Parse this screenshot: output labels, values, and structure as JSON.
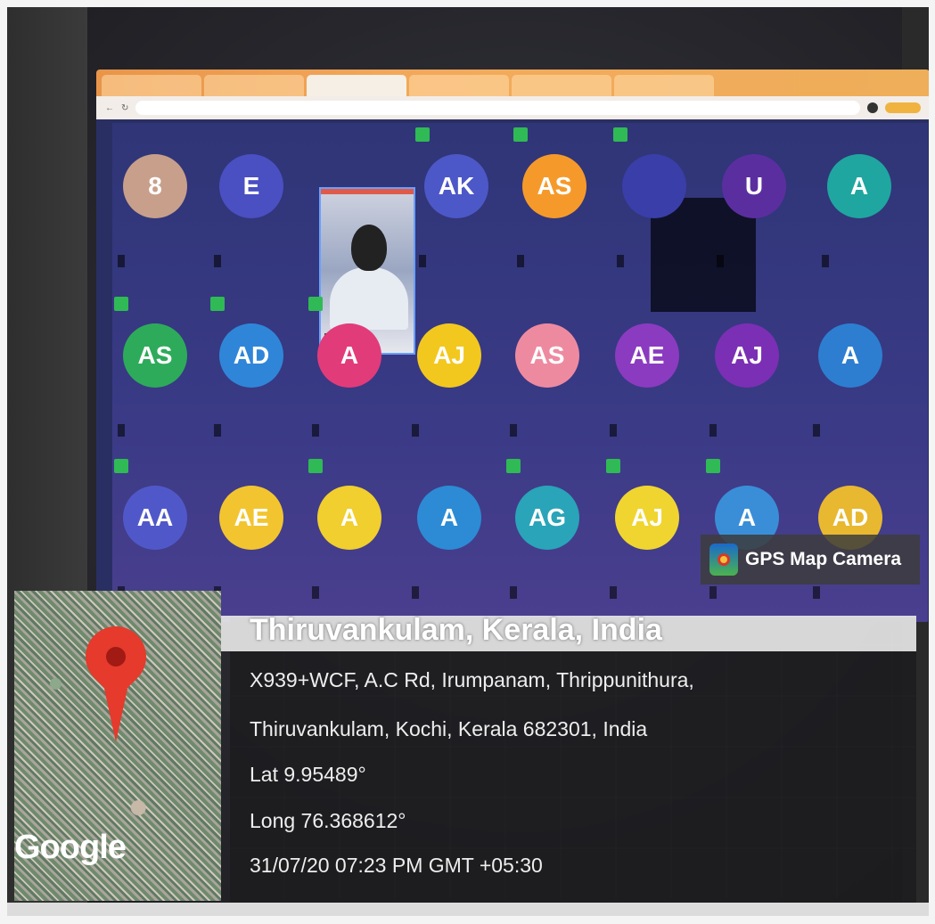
{
  "browser": {
    "tabs": [
      "",
      "",
      "",
      "",
      "",
      ""
    ],
    "url": ""
  },
  "meeting": {
    "tiles_row1": [
      {
        "initials": "8",
        "color": "#c89f8a",
        "name": ""
      },
      {
        "initials": "E",
        "color": "#4a4fc2",
        "name": ""
      },
      {
        "initials": "AK",
        "color": "#4c58c7",
        "name": ""
      },
      {
        "initials": "AS",
        "color": "#f59a2a",
        "name": ""
      },
      {
        "initials": "",
        "color": "#3a3ea8",
        "name": ""
      },
      {
        "initials": "U",
        "color": "#5b2ea0",
        "name": ""
      },
      {
        "initials": "A",
        "color": "#1fa6a0",
        "name": ""
      }
    ],
    "tiles_row2": [
      {
        "initials": "AS",
        "color": "#2dab5a",
        "name": ""
      },
      {
        "initials": "AD",
        "color": "#2f86d8",
        "name": ""
      },
      {
        "initials": "A",
        "color": "#e23b7a",
        "name": ""
      },
      {
        "initials": "AJ",
        "color": "#f2c81e",
        "name": ""
      },
      {
        "initials": "AS",
        "color": "#ee8aa0",
        "name": ""
      },
      {
        "initials": "AE",
        "color": "#8b3bc0",
        "name": ""
      },
      {
        "initials": "AJ",
        "color": "#7b2fb4",
        "name": ""
      },
      {
        "initials": "A",
        "color": "#2d7ed0",
        "name": ""
      }
    ],
    "tiles_row3": [
      {
        "initials": "AA",
        "color": "#5058c9",
        "name": ""
      },
      {
        "initials": "AE",
        "color": "#f2c530",
        "name": ""
      },
      {
        "initials": "A",
        "color": "#f0cf2e",
        "name": ""
      },
      {
        "initials": "A",
        "color": "#2c8bd4",
        "name": ""
      },
      {
        "initials": "AG",
        "color": "#2aa4b8",
        "name": ""
      },
      {
        "initials": "AJ",
        "color": "#f0d530",
        "name": ""
      },
      {
        "initials": "A",
        "color": "#3a8ed8",
        "name": ""
      },
      {
        "initials": "AD",
        "color": "#e8b830",
        "name": ""
      }
    ]
  },
  "gps": {
    "app_label": "GPS Map Camera",
    "place": "Thiruvankulam, Kerala, India",
    "address_line1": "X939+WCF, A.C Rd, Irumpanam, Thrippunithura,",
    "address_line2": "Thiruvankulam, Kochi, Kerala 682301, India",
    "lat": "Lat 9.95489°",
    "long": "Long 76.368612°",
    "timestamp": "31/07/20 07:23 PM GMT +05:30",
    "map_brand": "Google"
  },
  "colors": {
    "meet_bg": "#2f3576",
    "pin": "#e53a2c"
  }
}
